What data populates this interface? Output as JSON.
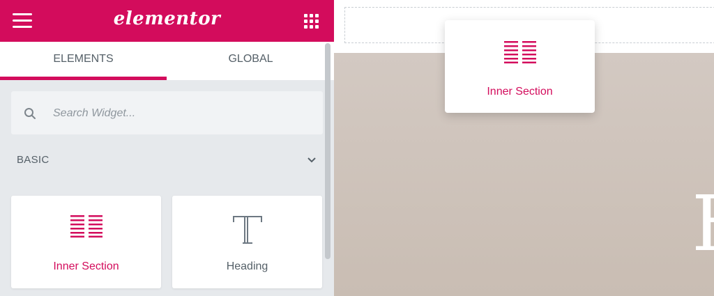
{
  "header": {
    "logo_text": "elementor",
    "menu_icon": "hamburger-icon",
    "apps_icon": "grid-icon",
    "brand_color": "#d30c5c"
  },
  "tabs": [
    {
      "label": "ELEMENTS",
      "active": true
    },
    {
      "label": "GLOBAL",
      "active": false
    }
  ],
  "search": {
    "placeholder": "Search Widget...",
    "value": "",
    "icon": "search-icon"
  },
  "category": {
    "label": "BASIC",
    "icon": "chevron-down-icon",
    "expanded": true
  },
  "widgets": [
    {
      "label": "Inner Section",
      "icon": "inner-section-icon"
    },
    {
      "label": "Heading",
      "icon": "heading-icon"
    }
  ],
  "drag_preview": {
    "label": "Inner Section",
    "icon": "inner-section-icon"
  },
  "canvas": {
    "add_icon": "plus-icon",
    "hero_glyph": "H",
    "hero_color": "#cfc4bc"
  }
}
